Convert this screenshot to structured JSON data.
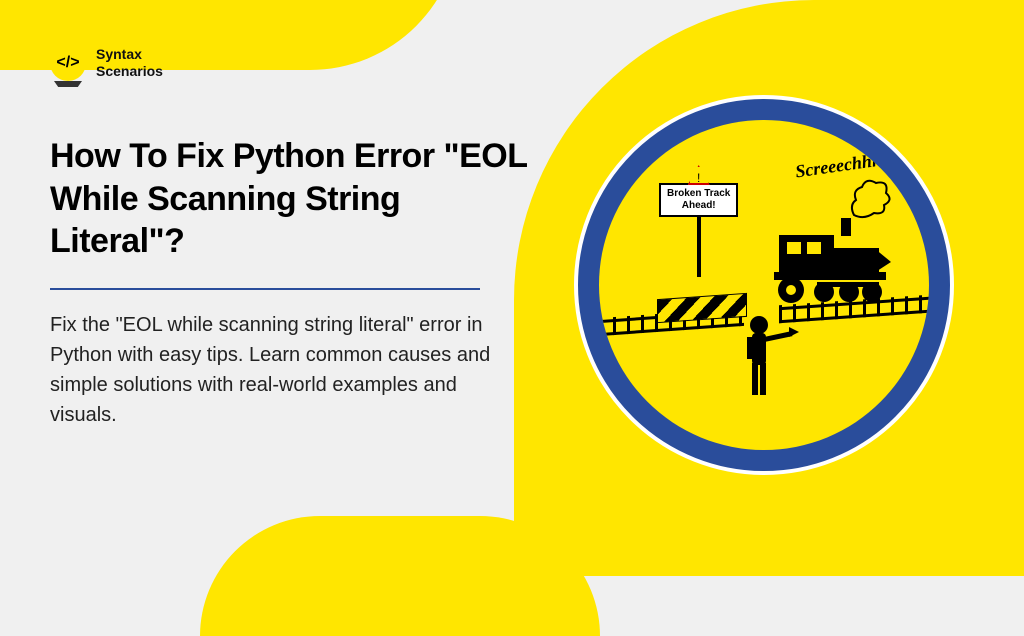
{
  "brand": {
    "name_line1": "Syntax",
    "name_line2": "Scenarios",
    "icon_glyph": "</>"
  },
  "article": {
    "title": "How To Fix Python Error \"EOL While Scanning String Literal\"?",
    "description": "Fix the \"EOL while scanning string literal\" error in Python with easy tips. Learn common causes and simple solutions with real-world examples and visuals."
  },
  "illustration": {
    "sign_line1": "Broken Track",
    "sign_line2": "Ahead!",
    "sound_effect": "Screeechhh!",
    "warn_glyph": "!"
  }
}
